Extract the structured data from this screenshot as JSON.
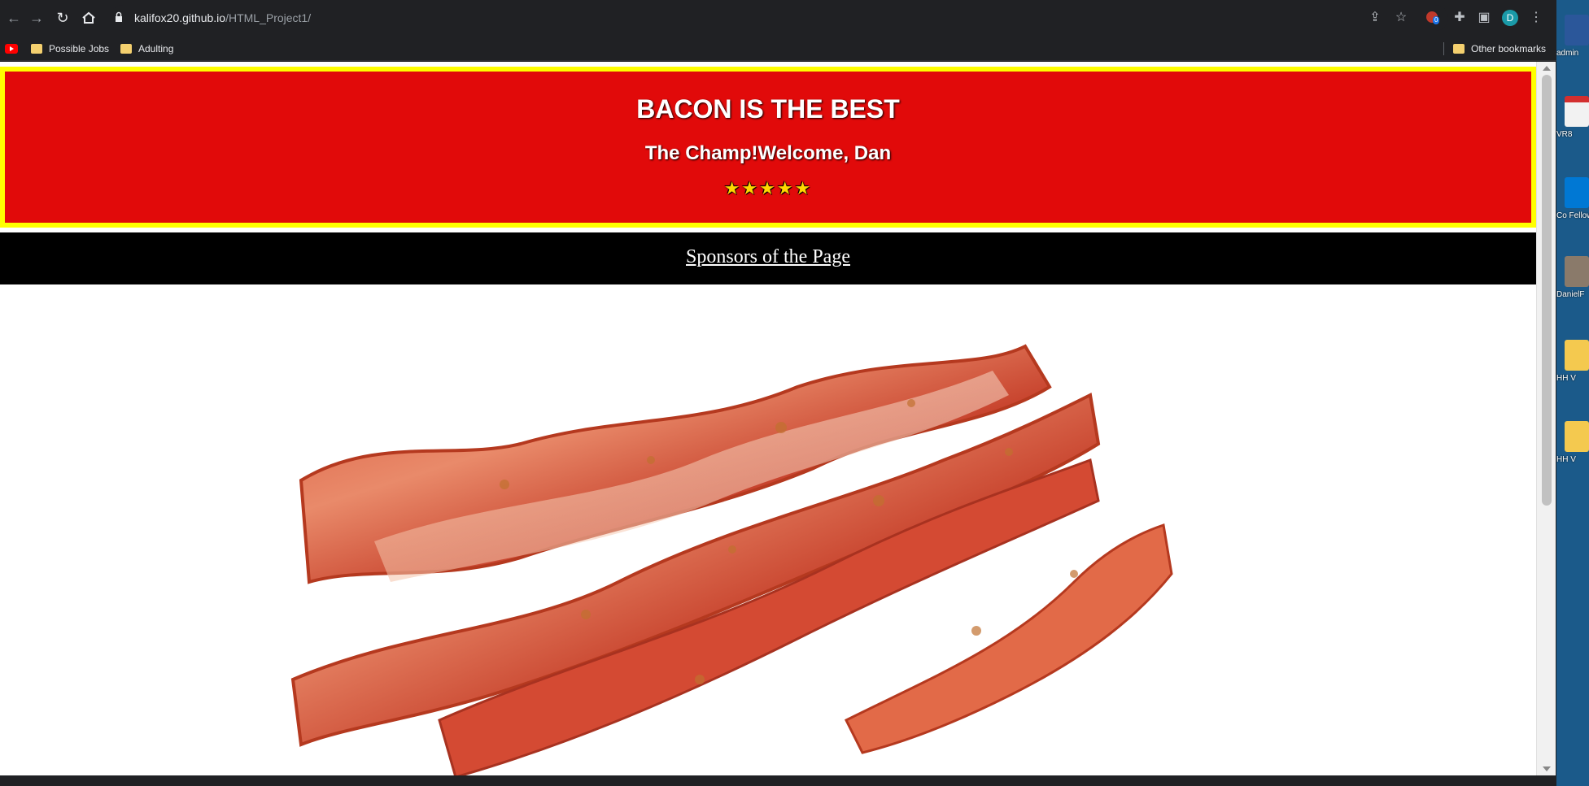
{
  "browser": {
    "url_domain": "kalifox20.github.io",
    "url_path": "/HTML_Project1/",
    "profile_initial": "D",
    "extension_badge": "0"
  },
  "bookmarks": {
    "items": [
      {
        "label": "Possible Jobs"
      },
      {
        "label": "Adulting"
      }
    ],
    "other_label": "Other bookmarks"
  },
  "page": {
    "title": "BACON IS THE BEST",
    "subtitle": "The Champ!Welcome, Dan",
    "stars": "★★★★★",
    "sponsors_link": "Sponsors of the Page",
    "colors": {
      "header_bg": "#e10a0a",
      "header_border": "#ffff00",
      "sponsor_bg": "#000000"
    }
  },
  "desktop": {
    "icons": [
      {
        "label": "admin",
        "icon": "word-doc-icon"
      },
      {
        "label": "VR8",
        "icon": "pdf-icon"
      },
      {
        "label": "Co Fellows",
        "icon": "outlook-icon"
      },
      {
        "label": "DanielF",
        "icon": "photo-icon"
      },
      {
        "label": "HH V",
        "icon": "folder-icon"
      },
      {
        "label": "HH V",
        "icon": "folder-icon"
      }
    ]
  }
}
